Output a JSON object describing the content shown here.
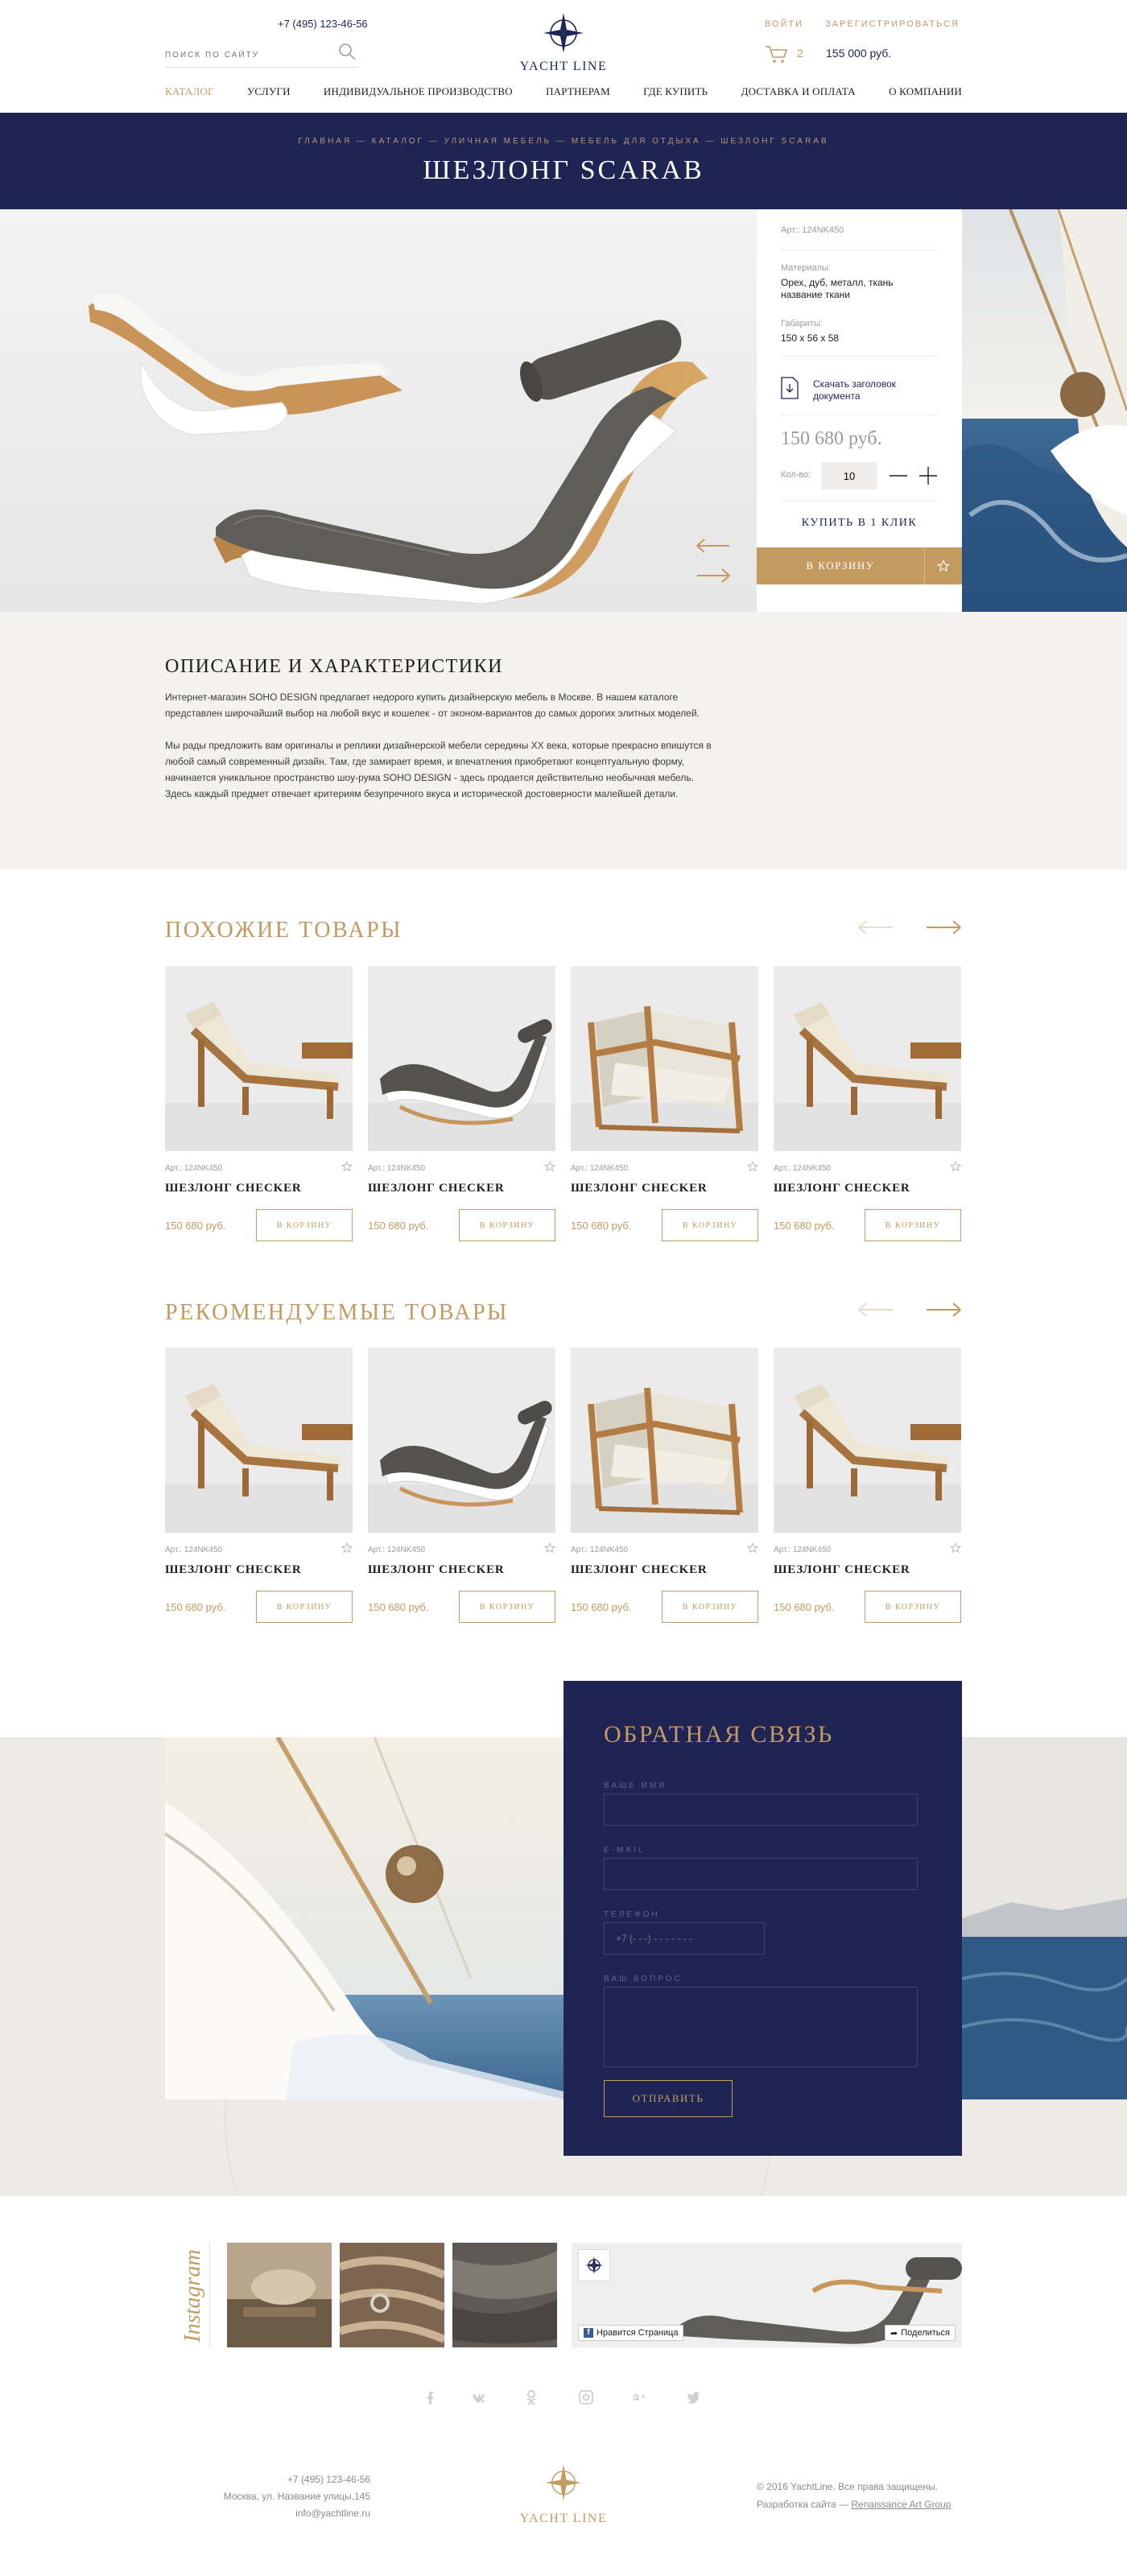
{
  "header": {
    "phone": "+7 (495) 123-46-56",
    "search_placeholder": "ПОИСК ПО САЙТУ",
    "logo_text": "YACHT LINE",
    "login": "ВОЙТИ",
    "register": "ЗАРЕГИСТРИРОВАТЬСЯ",
    "cart_count": "2",
    "cart_total": "155 000 руб."
  },
  "nav": [
    "КАТАЛОГ",
    "УСЛУГИ",
    "ИНДИВИДУАЛЬНОЕ ПРОИЗВОДСТВО",
    "ПАРТНЕРАМ",
    "ГДЕ КУПИТЬ",
    "ДОСТАВКА И ОПЛАТА",
    "О КОМПАНИИ"
  ],
  "breadcrumbs": "ГЛАВНАЯ — КАТАЛОГ — УЛИЧНАЯ МЕБЕЛЬ — МЕБЕЛЬ ДЛЯ ОТДЫХА — ШЕЗЛОНГ SCARAB",
  "page_title": "ШЕЗЛОНГ SCARAB",
  "product": {
    "article": "Арт.: 124NK450",
    "materials_label": "Материалы:",
    "materials_value": "Орех, дуб, металл, ткань название ткани",
    "dims_label": "Габариты:",
    "dims_value": "150 х 56 х 58",
    "download": "Скачать заголовок документа",
    "price": "150 680 руб.",
    "qty_label": "Кол-во:",
    "qty_value": "10",
    "one_click": "КУПИТЬ В 1 КЛИК",
    "to_cart": "В КОРЗИНУ"
  },
  "description": {
    "title": "ОПИСАНИЕ И ХАРАКТЕРИСТИКИ",
    "p1": "Интернет-магазин SOHO DESIGN предлагает недорого купить дизайнерскую мебель в Москве. В нашем каталоге представлен широчайший выбор на любой вкус и кошелек - от эконом-вариантов до самых дорогих элитных моделей.",
    "p2": "Мы рады предложить вам оригиналы и реплики дизайнерской мебели середины XX века, которые прекрасно впишутся в любой самый современный дизайн. Там, где замирает время, и впечатления приобретают концептуальную форму, начинается уникальное пространство шоу-рума SOHO DESIGN - здесь продается действительно необычная мебель. Здесь каждый предмет отвечает критериям безупречного вкуса и исторической достоверности малейшей детали."
  },
  "similar": {
    "title": "ПОХОЖИЕ ТОВАРЫ",
    "items": [
      {
        "img": "lounger-cream",
        "art": "Арт.: 124NK450",
        "name": "ШЕЗЛОНГ CHECKER",
        "price": "150 680 руб.",
        "btn": "В КОРЗИНУ"
      },
      {
        "img": "lounger-grey",
        "art": "Арт.: 124NK450",
        "name": "ШЕЗЛОНГ CHECKER",
        "price": "150 680 руб.",
        "btn": "В КОРЗИНУ"
      },
      {
        "img": "armchair",
        "art": "Арт.: 124NK450",
        "name": "ШЕЗЛОНГ CHECKER",
        "price": "150 680 руб.",
        "btn": "В КОРЗИНУ"
      },
      {
        "img": "lounger-cream",
        "art": "Арт.: 124NK450",
        "name": "ШЕЗЛОНГ CHECKER",
        "price": "150 680 руб.",
        "btn": "В КОРЗИНУ"
      }
    ]
  },
  "recommended": {
    "title": "РЕКОМЕНДУЕМЫЕ ТОВАРЫ",
    "items": [
      {
        "img": "lounger-cream",
        "art": "Арт.: 124NK450",
        "name": "ШЕЗЛОНГ CHECKER",
        "price": "150 680 руб.",
        "btn": "В КОРЗИНУ"
      },
      {
        "img": "lounger-grey",
        "art": "Арт.: 124NK450",
        "name": "ШЕЗЛОНГ CHECKER",
        "price": "150 680 руб.",
        "btn": "В КОРЗИНУ"
      },
      {
        "img": "armchair",
        "art": "Арт.: 124NK450",
        "name": "ШЕЗЛОНГ CHECKER",
        "price": "150 680 руб.",
        "btn": "В КОРЗИНУ"
      },
      {
        "img": "lounger-cream",
        "art": "Арт.: 124NK450",
        "name": "ШЕЗЛОНГ CHECKER",
        "price": "150 680 руб.",
        "btn": "В КОРЗИНУ"
      }
    ]
  },
  "feedback": {
    "title": "ОБРАТНАЯ СВЯЗЬ",
    "name_label": "ВАШЕ ИМЯ",
    "email_label": "E-MAIL",
    "phone_label": "ТЕЛЕФОН",
    "phone_placeholder": "+7 (- - -) - - - - - - -",
    "question_label": "ВАШ ВОПРОС",
    "submit": "ОТПРАВИТЬ"
  },
  "instagram": {
    "title": "Instagram",
    "like": "Нравится Страница",
    "share": "Поделиться"
  },
  "social_icons": [
    "facebook-icon",
    "vk-icon",
    "odnoklassniki-icon",
    "instagram-icon",
    "google-plus-icon",
    "twitter-icon"
  ],
  "footer": {
    "phone": "+7 (495) 123-46-56",
    "address": "Москва, ул. Название улицы,145",
    "email": "info@yachtline.ru",
    "logo_text": "YACHT LINE",
    "copyright": "© 2016 YachtLine. Все права защищены.",
    "dev_prefix": "Разработка сайта —",
    "dev_link": "Renaissance Art Group"
  },
  "colors": {
    "navy": "#1e2554",
    "gold": "#c39a60",
    "light_bg": "#f4f2ef"
  }
}
